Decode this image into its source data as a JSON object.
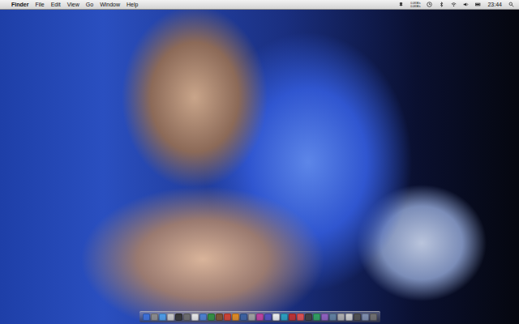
{
  "menubar": {
    "apple": "",
    "menus": [
      {
        "label": "Finder",
        "bold": true
      },
      {
        "label": "File",
        "bold": false
      },
      {
        "label": "Edit",
        "bold": false
      },
      {
        "label": "View",
        "bold": false
      },
      {
        "label": "Go",
        "bold": false
      },
      {
        "label": "Window",
        "bold": false
      },
      {
        "label": "Help",
        "bold": false
      }
    ],
    "netstats": [
      "0.0KB/s",
      "0.0KB/s"
    ],
    "clock": "23:44"
  },
  "dock": {
    "items": [
      {
        "color": "#3b6fd8"
      },
      {
        "color": "#8a8a8a"
      },
      {
        "color": "#4a9be8"
      },
      {
        "color": "#c9c9c9"
      },
      {
        "color": "#333333"
      },
      {
        "color": "#6b6b6b"
      },
      {
        "color": "#e8e8e8"
      },
      {
        "color": "#4a7fd0"
      },
      {
        "color": "#2f8f3f"
      },
      {
        "color": "#7a5030"
      },
      {
        "color": "#d04030"
      },
      {
        "color": "#e08a20"
      },
      {
        "color": "#3a60a0"
      },
      {
        "color": "#a0a0a0"
      },
      {
        "color": "#c040a0"
      },
      {
        "color": "#5050c0"
      },
      {
        "color": "#f0f0f0"
      },
      {
        "color": "#2aa0c0"
      },
      {
        "color": "#c03030"
      },
      {
        "color": "#e05050"
      },
      {
        "color": "#404040"
      },
      {
        "color": "#30a060"
      },
      {
        "color": "#9060c0"
      },
      {
        "color": "#6080a0"
      },
      {
        "color": "#b0b0b0"
      },
      {
        "color": "#d0d0d0"
      },
      {
        "color": "#505050"
      },
      {
        "color": "#8090b0"
      },
      {
        "color": "#707070"
      }
    ]
  }
}
